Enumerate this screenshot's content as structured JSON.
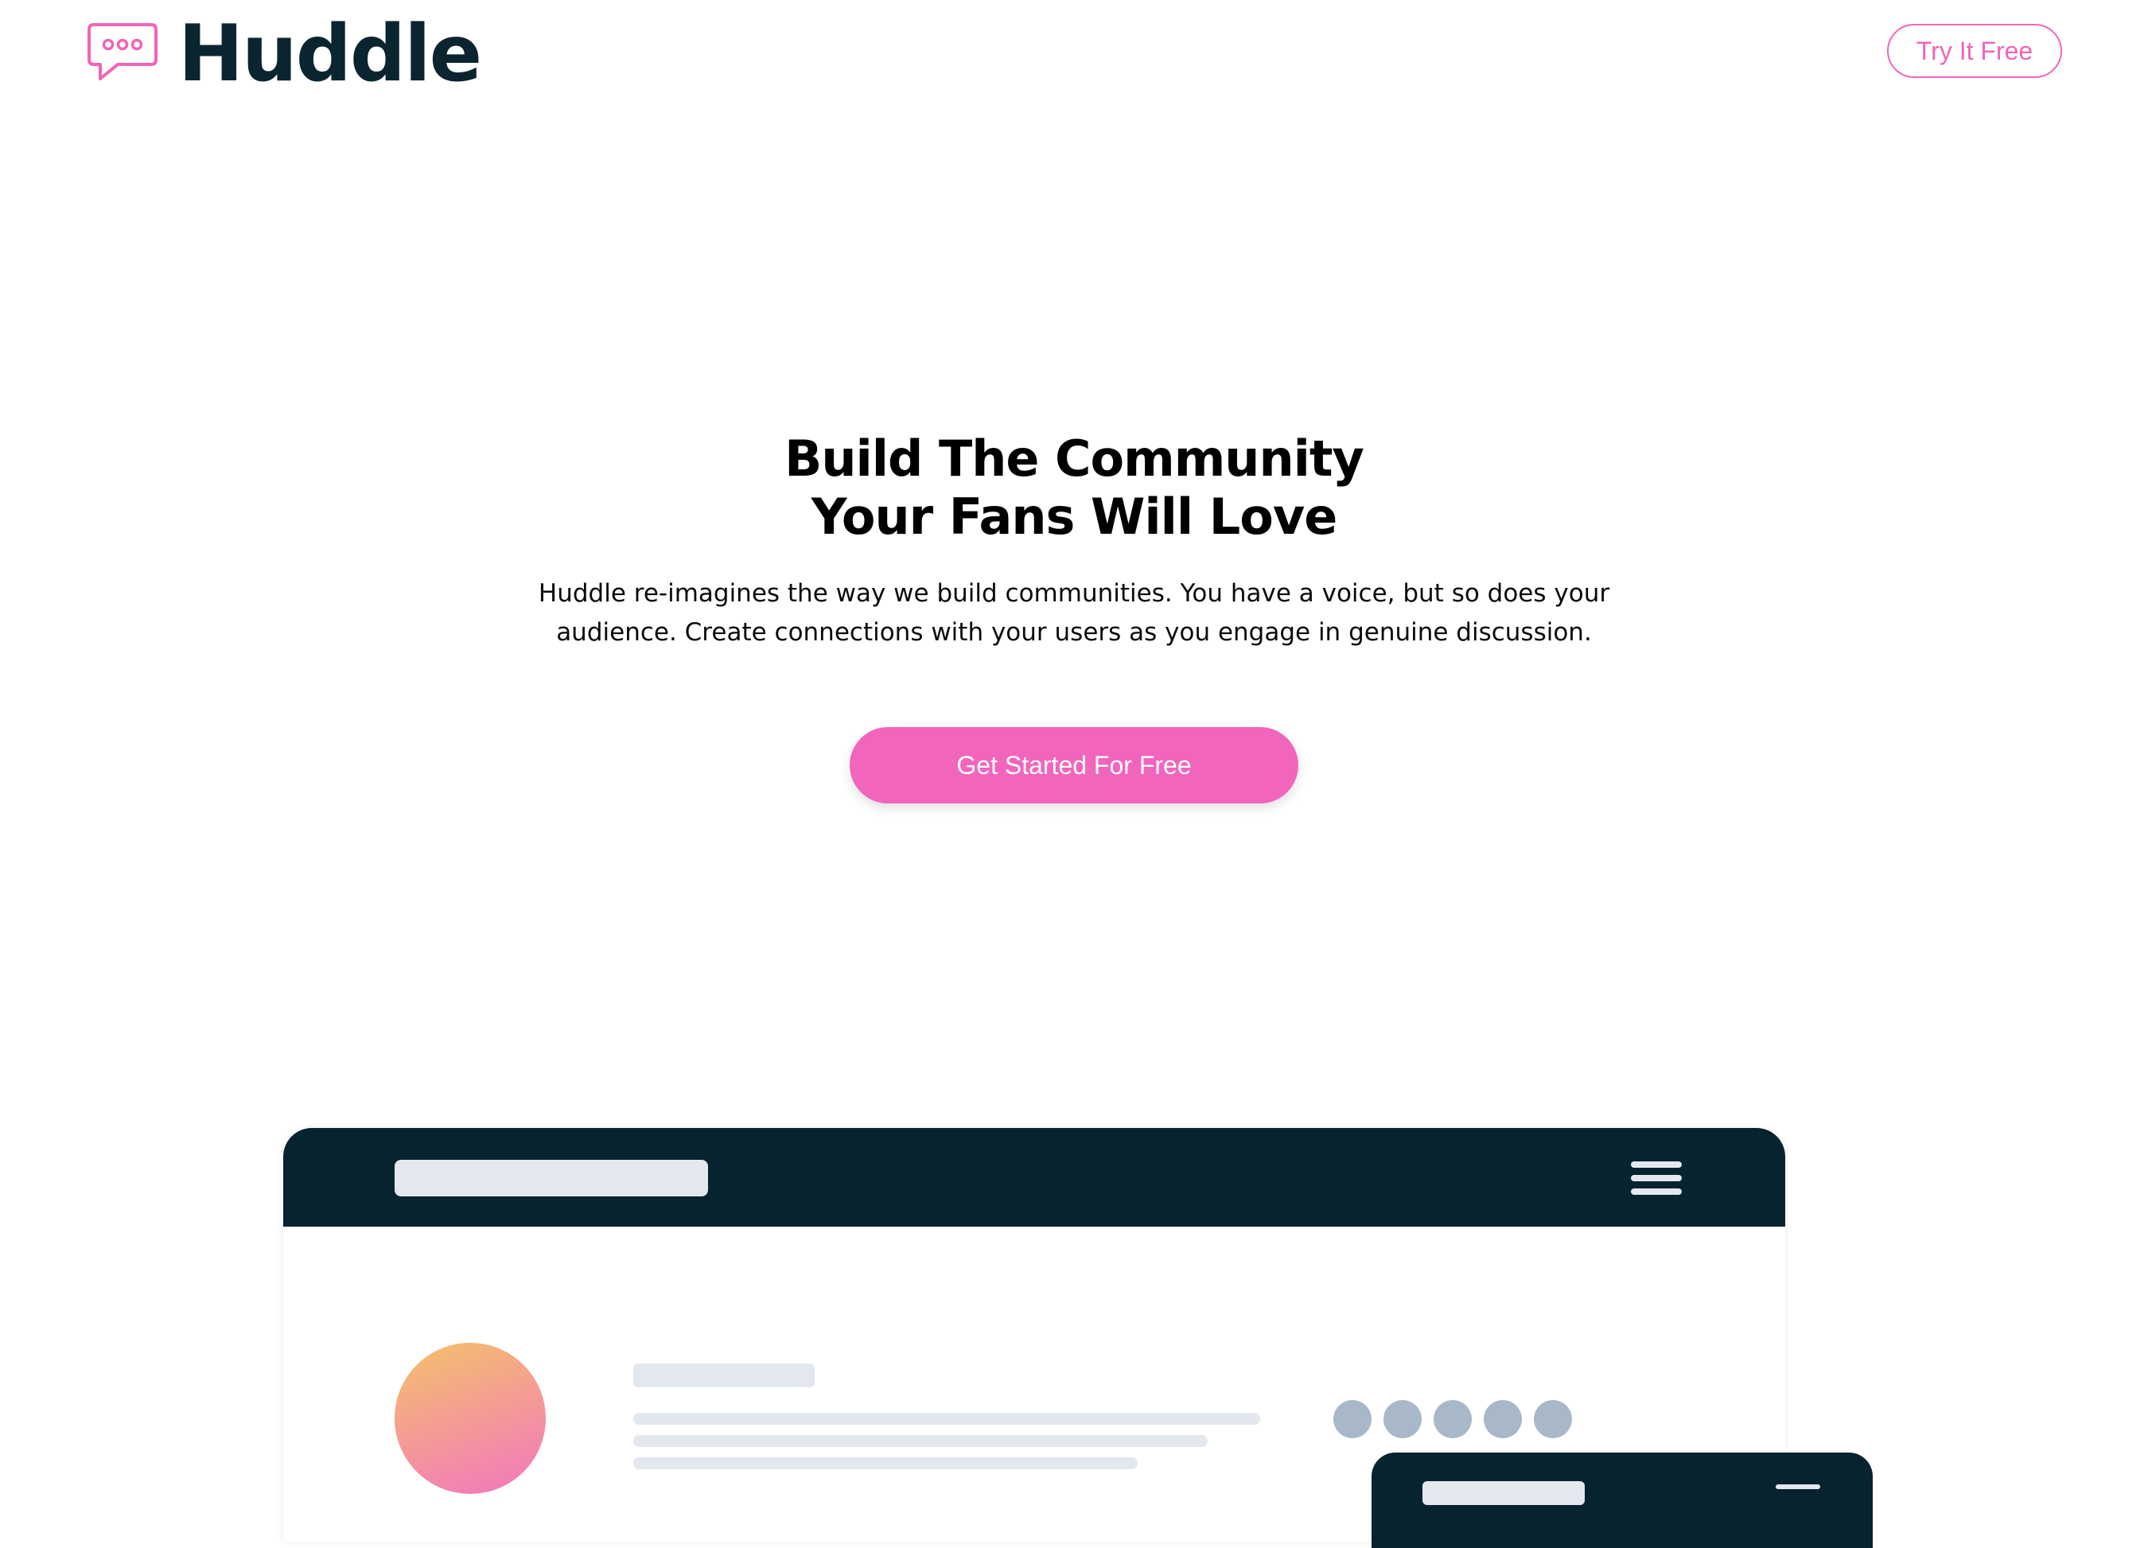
{
  "brand": {
    "name": "Huddle",
    "icon": "chat-bubble-icon",
    "accent_color": "#f065b8",
    "dark_color": "#0b2530"
  },
  "header": {
    "try_label": "Try It Free"
  },
  "hero": {
    "title_line1": "Build The Community",
    "title_line2": "Your Fans Will Love",
    "description": "Huddle re-imagines the way we build communities. You have a voice, but so does your audience. Create connections with your users as you engage in genuine discussion.",
    "cta_label": "Get Started For Free"
  },
  "mockup": {
    "menu_icon": "hamburger-menu-icon",
    "avatar_gradient": [
      "#f5c16a",
      "#f276c0"
    ],
    "dot_color": "#a9b8c8",
    "placeholder_color": "#e3e8ef",
    "bar_color": "#082330"
  }
}
